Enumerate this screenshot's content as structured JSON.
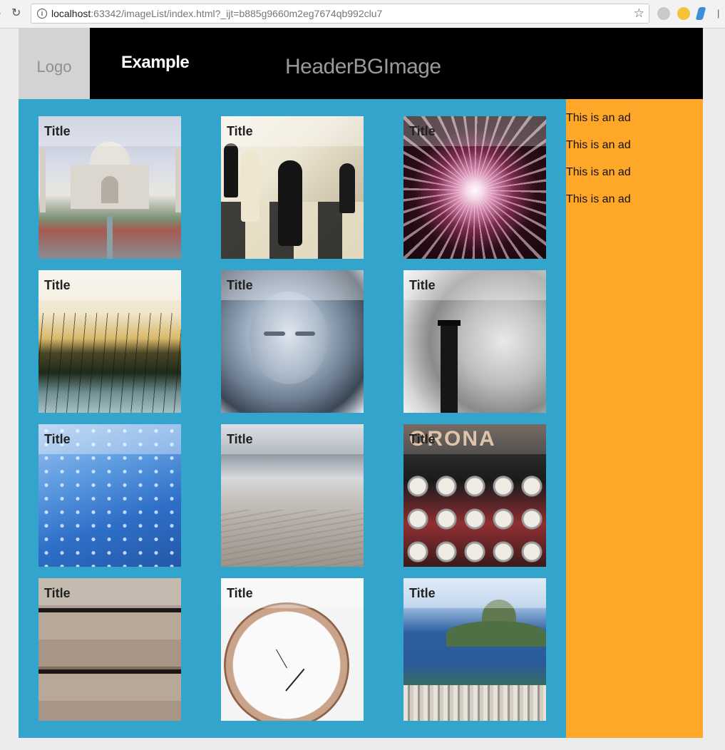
{
  "browser": {
    "url_host": "localhost",
    "url_rest": ":63342/imageList/index.html?_ijt=b885g9660m2eg7674qb992clu7"
  },
  "header": {
    "logo": "Logo",
    "brand": "Example",
    "bg_label": "HeaderBGImage"
  },
  "gallery": {
    "tiles": [
      {
        "title": "Title",
        "icon": "taj-mahal-photo"
      },
      {
        "title": "Title",
        "icon": "chess-photo"
      },
      {
        "title": "Title",
        "icon": "fireworks-photo"
      },
      {
        "title": "Title",
        "icon": "grass-sunset-photo"
      },
      {
        "title": "Title",
        "icon": "statue-photo"
      },
      {
        "title": "Title",
        "icon": "smokestack-photo"
      },
      {
        "title": "Title",
        "icon": "water-drops-photo"
      },
      {
        "title": "Title",
        "icon": "dunes-photo"
      },
      {
        "title": "Title",
        "icon": "typewriter-photo"
      },
      {
        "title": "Title",
        "icon": "wood-planks-photo"
      },
      {
        "title": "Title",
        "icon": "pocket-watch-photo"
      },
      {
        "title": "Title",
        "icon": "rio-photo"
      }
    ]
  },
  "sidebar": {
    "ads": [
      "This is an ad",
      "This is an ad",
      "This is an ad",
      "This is an ad"
    ]
  },
  "colors": {
    "main_bg": "#33a5cc",
    "aside_bg": "#ffa729",
    "header_bg": "#000000"
  }
}
